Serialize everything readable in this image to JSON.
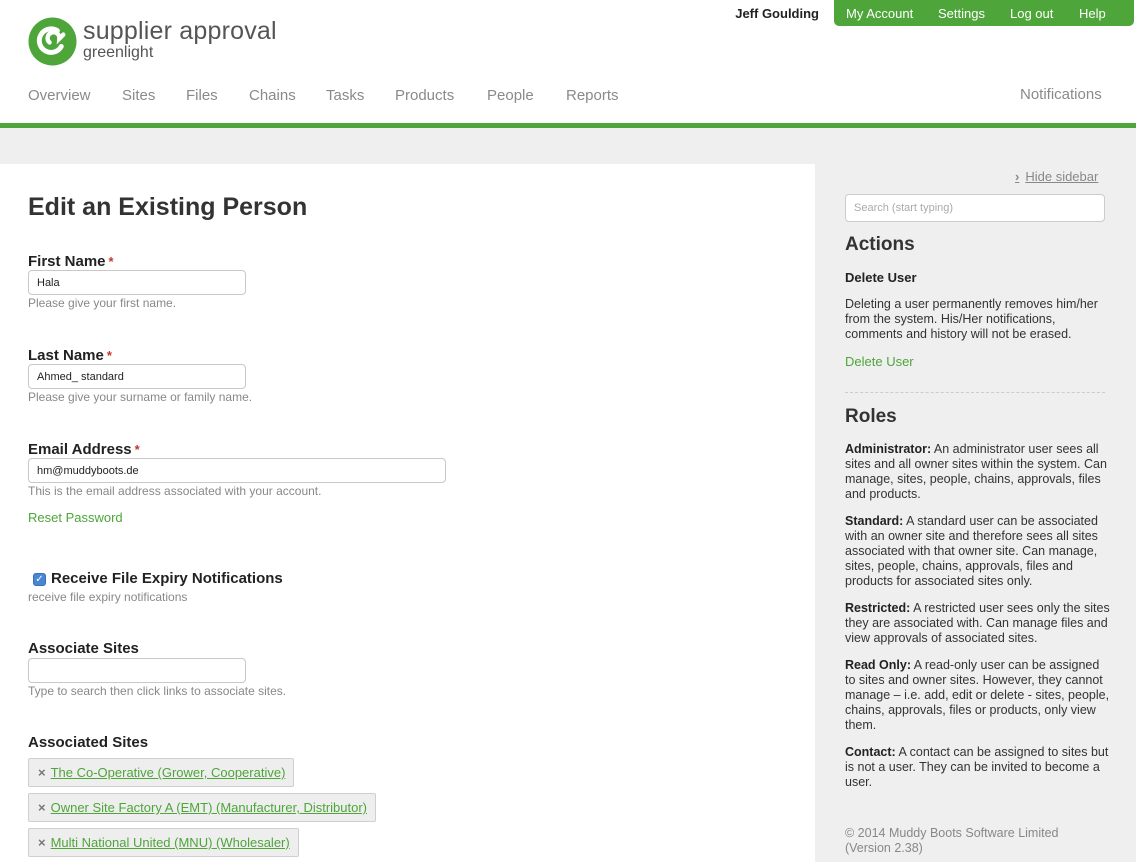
{
  "brand": {
    "title": "supplier approval",
    "subtitle": "greenlight",
    "color": "#4ea53a"
  },
  "user": {
    "name": "Jeff Goulding"
  },
  "top_menu": [
    "My Account",
    "Settings",
    "Log out",
    "Help"
  ],
  "nav": [
    "Overview",
    "Sites",
    "Files",
    "Chains",
    "Tasks",
    "Products",
    "People",
    "Reports"
  ],
  "notifications_label": "Notifications",
  "page": {
    "title": "Edit an Existing Person",
    "required_marker": "*"
  },
  "form": {
    "first_name": {
      "label": "First Name",
      "value": "Hala",
      "help": "Please give your first name."
    },
    "last_name": {
      "label": "Last Name",
      "value": "Ahmed_ standard",
      "help": "Please give your surname or family name."
    },
    "email": {
      "label": "Email Address",
      "value": "hm@muddyboots.de",
      "help": "This is the email address associated with your account."
    },
    "reset_password": "Reset Password",
    "expiry": {
      "label": "Receive File Expiry Notifications",
      "help": "receive file expiry notifications",
      "checked": true
    },
    "associate_sites": {
      "label": "Associate Sites",
      "value": "",
      "help": "Type to search then click links to associate sites."
    },
    "associated_sites": {
      "label": "Associated Sites",
      "remove_icon": "×",
      "items": [
        "The Co-Operative (Grower, Cooperative)",
        "Owner Site Factory A (EMT) (Manufacturer, Distributor)",
        "Multi National United (MNU) (Wholesaler)"
      ]
    }
  },
  "sidebar": {
    "hide_label": "Hide sidebar",
    "search_placeholder": "Search (start typing)",
    "actions_title": "Actions",
    "delete_heading": "Delete User",
    "delete_text": "Deleting a user permanently removes him/her from the system. His/Her notifications, comments and history will not be erased.",
    "delete_link": "Delete User",
    "roles_title": "Roles",
    "roles": [
      {
        "name": "Administrator:",
        "text": "An administrator user sees all sites and all owner sites within the system. Can manage, sites, people, chains, approvals, files and products."
      },
      {
        "name": "Standard:",
        "text": "A standard user can be associated with an owner site and therefore sees all sites associated with that owner site. Can manage, sites, people, chains, approvals, files and products for associated sites only."
      },
      {
        "name": "Restricted:",
        "text": "A restricted user sees only the sites they are associated with. Can manage files and view approvals of associated sites."
      },
      {
        "name": "Read Only:",
        "text": "A read-only user can be assigned to sites and owner sites. However, they cannot manage – i.e. add, edit or delete - sites, people, chains, approvals, files or products, only view them."
      },
      {
        "name": "Contact:",
        "text": "A contact can be assigned to sites but is not a user. They can be invited to become a user."
      }
    ],
    "copyright": "© 2014 Muddy Boots Software Limited",
    "version": "(Version 2.38)"
  }
}
